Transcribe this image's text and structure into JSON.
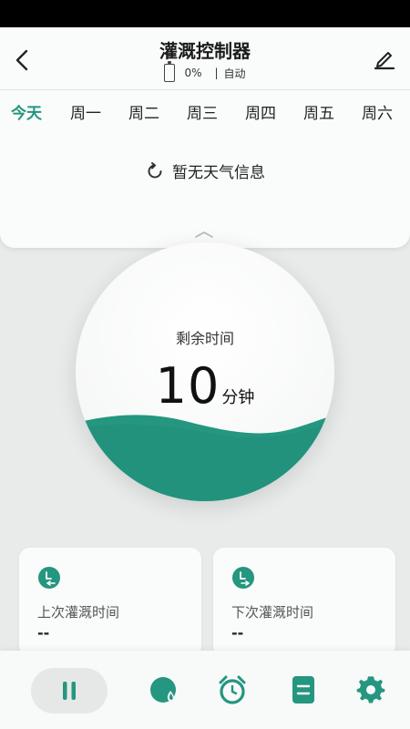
{
  "colors": {
    "accent": "#25967f",
    "accent_dark": "#1f8a73",
    "background": "#e8ebea",
    "card": "#fafbfb"
  },
  "header": {
    "title": "灌溉控制器",
    "battery_percent": "0%",
    "separator": "|",
    "mode": "自动",
    "back_icon": "chevron-left-icon",
    "edit_icon": "pencil-icon"
  },
  "days": [
    "今天",
    "周一",
    "周二",
    "周三",
    "周四",
    "周五",
    "周六"
  ],
  "weather": {
    "text": "暂无天气信息",
    "icon": "refresh-icon"
  },
  "dial": {
    "label": "剩余时间",
    "value": "10",
    "unit": "分钟"
  },
  "cards": {
    "last": {
      "label": "上次灌溉时间",
      "value": "--",
      "icon": "clock-back-icon"
    },
    "next": {
      "label": "下次灌溉时间",
      "value": "--",
      "icon": "clock-forward-icon"
    }
  },
  "bottom_nav": [
    {
      "name": "pause-icon"
    },
    {
      "name": "water-drop-icon"
    },
    {
      "name": "alarm-clock-icon"
    },
    {
      "name": "list-icon"
    },
    {
      "name": "gear-icon"
    }
  ]
}
